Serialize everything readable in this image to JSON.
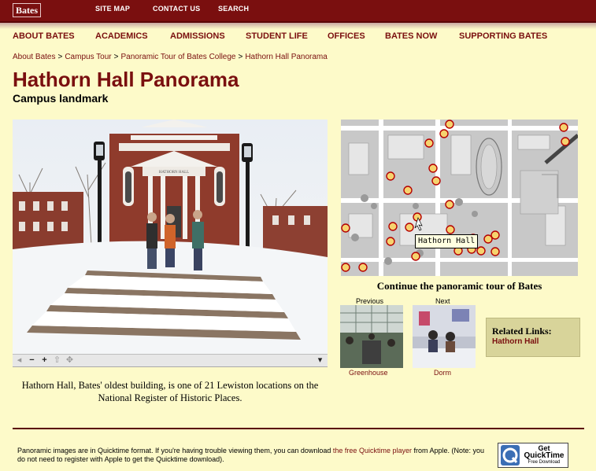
{
  "header": {
    "logo": "Bates",
    "links": [
      "SITE MAP",
      "CONTACT US",
      "SEARCH"
    ]
  },
  "nav": [
    "ABOUT BATES",
    "ACADEMICS",
    "ADMISSIONS",
    "STUDENT LIFE",
    "OFFICES",
    "BATES NOW",
    "SUPPORTING BATES"
  ],
  "breadcrumb": [
    "About Bates",
    "Campus Tour",
    "Panoramic Tour of Bates College",
    "Hathorn Hall Panorama"
  ],
  "breadcrumb_sep": ">",
  "page": {
    "title": "Hathorn Hall Panorama",
    "subtitle": "Campus landmark",
    "caption": "Hathorn Hall, Bates' oldest building, is one of 21 Lewiston locations on the National Register of Historic Places.",
    "panorama_sign": "HATHORN HALL"
  },
  "map": {
    "tooltip": "Hathorn Hall",
    "continue": "Continue the panoramic tour of Bates"
  },
  "thumbs": {
    "prev_label": "Previous",
    "next_label": "Next",
    "prev_caption": "Greenhouse",
    "next_caption": "Dorm"
  },
  "related": {
    "heading": "Related Links:",
    "link": "Hathorn Hall"
  },
  "footer": {
    "text1": "Panoramic images are in Quicktime format. If you're having trouble viewing them, you can download ",
    "link": "the free Quicktime player",
    "text2": " from Apple. (Note: you do not need to register with Apple to get the Quicktime download).",
    "badge_line1": "Get",
    "badge_line2": "QuickTime",
    "badge_line3": "Free Download"
  },
  "colors": {
    "brand": "#7a0f0f",
    "background": "#fdfac9",
    "related_bg": "#d8d49a"
  }
}
